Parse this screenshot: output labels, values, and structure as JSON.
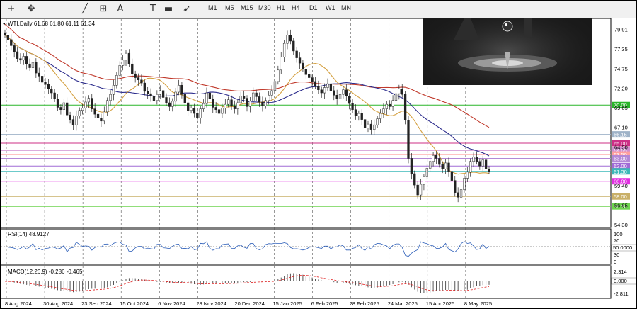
{
  "toolbar": {
    "tools": [
      {
        "name": "crosshair-icon",
        "glyph": "+"
      },
      {
        "name": "cursor-move-icon",
        "glyph": "✥"
      },
      {
        "name": "hline-icon",
        "glyph": "—"
      },
      {
        "name": "trendline-icon",
        "glyph": "╱"
      },
      {
        "name": "fibo-icon",
        "glyph": "⊞"
      },
      {
        "name": "text-icon",
        "glyph": "A"
      },
      {
        "name": "label-icon",
        "glyph": "T"
      },
      {
        "name": "shape-icon",
        "glyph": "▬"
      },
      {
        "name": "arrow-dropdown-icon",
        "glyph": "➹"
      }
    ],
    "timeframes": [
      "M1",
      "M5",
      "M15",
      "M30",
      "H1",
      "H4",
      "D1",
      "W1",
      "MN"
    ]
  },
  "main": {
    "header": "WTI,Daily  61.68 61.80 61.11 61.34",
    "price_labels": [
      {
        "v": 79.91,
        "t": "79.91"
      },
      {
        "v": 77.35,
        "t": "77.35"
      },
      {
        "v": 74.75,
        "t": "74.75"
      },
      {
        "v": 72.2,
        "t": "72.20"
      },
      {
        "v": 69.65,
        "t": "69.65"
      },
      {
        "v": 67.1,
        "t": "67.10"
      },
      {
        "v": 64.5,
        "t": "64.50"
      },
      {
        "v": 59.4,
        "t": "59.40"
      },
      {
        "v": 56.85,
        "t": "56.85"
      },
      {
        "v": 54.3,
        "t": "54.30"
      }
    ],
    "levels": [
      {
        "v": 70.0,
        "t": "70.00",
        "color": "#2ab52a"
      },
      {
        "v": 66.15,
        "t": "66.15",
        "color": "#9fb3c8"
      },
      {
        "v": 65.0,
        "t": "65.00",
        "color": "#cc2f86"
      },
      {
        "v": 64.05,
        "t": "64.05",
        "color": "#d08fd0"
      },
      {
        "v": 63.5,
        "t": "63.50",
        "color": "#ff9f9f"
      },
      {
        "v": 63.0,
        "t": "63.00",
        "color": "#b388d6"
      },
      {
        "v": 62.0,
        "t": "62.00",
        "color": "#a06bd6"
      },
      {
        "v": 61.3,
        "t": "61.30",
        "color": "#3cb8b8"
      },
      {
        "v": 60.0,
        "t": "60.00",
        "color": "#e02fe0"
      },
      {
        "v": 58.0,
        "t": "58.00",
        "color": "#c9b068"
      },
      {
        "v": 56.7,
        "t": "56.70",
        "color": "#6dd44f"
      }
    ],
    "date_labels": [
      "8 Aug 2024",
      "30 Aug 2024",
      "23 Sep 2024",
      "15 Oct 2024",
      "6 Nov 2024",
      "28 Nov 2024",
      "20 Dec 2024",
      "15 Jan 2025",
      "6 Feb 2025",
      "28 Feb 2025",
      "24 Mar 2025",
      "15 Apr 2025",
      "8 May 2025"
    ]
  },
  "rsi": {
    "header": "RSI(14) 48.9127",
    "labels": [
      "100",
      "70",
      "50.0000",
      "30",
      "0"
    ]
  },
  "macd": {
    "header": "MACD(12,26,9) -0.286 -0.465",
    "labels": [
      "2.314",
      "0.000",
      "-2.811"
    ]
  },
  "colors": {
    "up": "#2a2a2a",
    "ma_red": "#c0392b",
    "ma_blue": "#2c2c8c",
    "ma_orange": "#d4a040",
    "rsi_line": "#2b5db8",
    "macd_signal": "#e02020",
    "label_bg": "#ffffff"
  },
  "chart_data": {
    "type": "candlestick",
    "symbol": "WTI",
    "timeframe": "Daily",
    "last_bar": {
      "open": 61.68,
      "high": 61.8,
      "low": 61.11,
      "close": 61.34
    },
    "ylim": [
      54.3,
      81.0
    ],
    "closes": [
      79.2,
      78.6,
      77.8,
      77.0,
      76.1,
      75.9,
      76.4,
      75.4,
      74.9,
      75.6,
      74.2,
      73.8,
      73.0,
      72.7,
      72.1,
      71.6,
      70.8,
      69.7,
      69.4,
      70.3,
      68.7,
      68.1,
      67.4,
      68.6,
      69.3,
      69.6,
      70.4,
      70.9,
      69.5,
      68.8,
      68.3,
      67.9,
      69.1,
      70.6,
      71.4,
      72.6,
      73.9,
      75.2,
      75.9,
      76.8,
      75.4,
      74.1,
      73.6,
      73.3,
      72.9,
      71.8,
      71.5,
      71.2,
      70.6,
      71.4,
      71.9,
      71.0,
      70.3,
      69.8,
      70.5,
      71.7,
      72.6,
      71.4,
      70.3,
      69.3,
      69.6,
      68.9,
      68.3,
      69.5,
      70.2,
      71.6,
      70.8,
      69.7,
      69.4,
      68.9,
      69.6,
      70.1,
      70.7,
      69.9,
      69.5,
      70.3,
      71.2,
      70.9,
      69.8,
      70.5,
      71.6,
      71.1,
      70.4,
      69.9,
      70.6,
      71.3,
      71.9,
      73.1,
      74.6,
      76.3,
      78.1,
      79.2,
      78.4,
      77.1,
      76.2,
      75.5,
      74.7,
      74.0,
      73.6,
      73.1,
      72.5,
      72.0,
      71.6,
      72.3,
      72.8,
      71.9,
      71.3,
      70.8,
      71.4,
      72.0,
      71.2,
      70.2,
      69.4,
      68.6,
      68.9,
      68.1,
      67.0,
      67.5,
      66.8,
      67.4,
      68.2,
      68.9,
      69.5,
      70.1,
      69.8,
      70.6,
      71.5,
      72.1,
      71.4,
      68.0,
      63.0,
      61.0,
      59.5,
      58.2,
      59.6,
      60.6,
      61.7,
      62.6,
      63.4,
      63.0,
      62.2,
      61.6,
      62.4,
      61.3,
      60.1,
      58.5,
      57.9,
      58.9,
      60.4,
      61.2,
      62.6,
      63.2,
      62.6,
      62.0,
      62.8,
      61.6,
      61.3
    ]
  }
}
